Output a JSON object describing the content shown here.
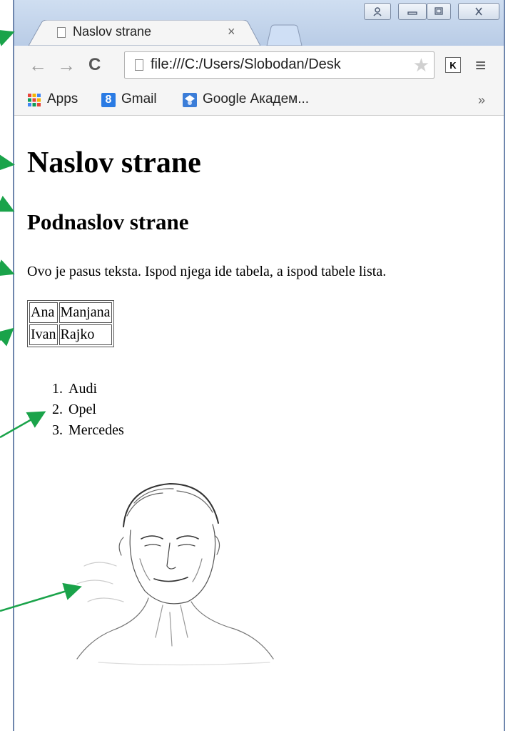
{
  "window": {
    "controls": {
      "user_icon": "user-icon",
      "minimize_icon": "minimize-icon",
      "maximize_icon": "maximize-icon",
      "close_icon": "close-icon"
    }
  },
  "tab": {
    "title": "Naslov strane",
    "close": "×"
  },
  "toolbar": {
    "back": "←",
    "forward": "→",
    "reload": "C",
    "url": "file:///C:/Users/Slobodan/Desk",
    "extension_label": "K",
    "menu": "≡"
  },
  "bookmarks": {
    "apps": "Apps",
    "gmail": "Gmail",
    "gmail_icon_letter": "8",
    "scholar": "Google Академ...",
    "more": "»"
  },
  "page": {
    "heading": "Naslov strane",
    "subheading": "Podnaslov strane",
    "paragraph": "Ovo je pasus teksta. Ispod njega ide tabela, a ispod tabele lista.",
    "table": [
      [
        "Ana",
        "Manjana"
      ],
      [
        "Ivan",
        "Rajko"
      ]
    ],
    "list": [
      {
        "num": "1.",
        "label": "Audi"
      },
      {
        "num": "2.",
        "label": "Opel"
      },
      {
        "num": "3.",
        "label": "Mercedes"
      }
    ]
  },
  "colors": {
    "titlebar": "#c4d5ec",
    "window_border": "#6f86ad",
    "arrow": "#1aa34a"
  }
}
